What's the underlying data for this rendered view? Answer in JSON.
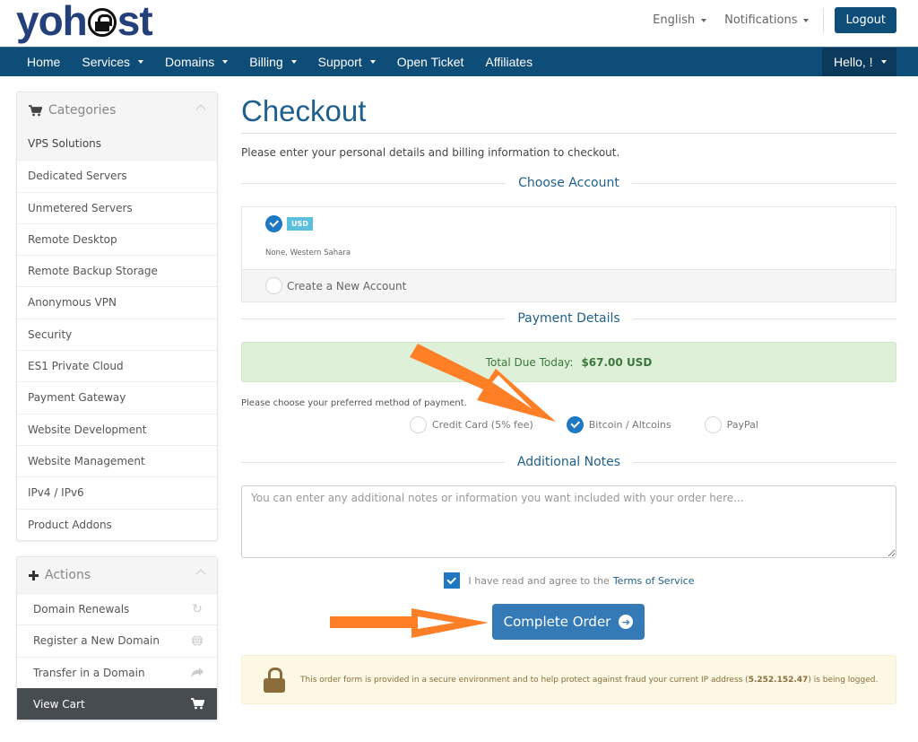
{
  "header": {
    "logo_text_left": "yoh",
    "logo_text_right": "st",
    "language": "English",
    "notifications": "Notifications",
    "logout": "Logout"
  },
  "nav": {
    "items": [
      {
        "label": "Home",
        "dropdown": false
      },
      {
        "label": "Services",
        "dropdown": true
      },
      {
        "label": "Domains",
        "dropdown": true
      },
      {
        "label": "Billing",
        "dropdown": true
      },
      {
        "label": "Support",
        "dropdown": true
      },
      {
        "label": "Open Ticket",
        "dropdown": false
      },
      {
        "label": "Affiliates",
        "dropdown": false
      }
    ],
    "account": "Hello, !"
  },
  "sidebar": {
    "categories_title": "Categories",
    "categories": [
      "VPS Solutions",
      "Dedicated Servers",
      "Unmetered Servers",
      "Remote Desktop",
      "Remote Backup Storage",
      "Anonymous VPN",
      "Security",
      "ES1 Private Cloud",
      "Payment Gateway",
      "Website Development",
      "Website Management",
      "IPv4 / IPv6",
      "Product Addons"
    ],
    "active_category": "VPS Solutions",
    "actions_title": "Actions",
    "actions": [
      {
        "label": "Domain Renewals",
        "icon": "refresh-icon"
      },
      {
        "label": "Register a New Domain",
        "icon": "globe-icon"
      },
      {
        "label": "Transfer in a Domain",
        "icon": "share-arrow-icon"
      },
      {
        "label": "View Cart",
        "icon": "cart-icon"
      }
    ]
  },
  "main": {
    "title": "Checkout",
    "intro": "Please enter your personal details and billing information to checkout.",
    "choose_account": {
      "heading": "Choose Account",
      "existing": {
        "currency": "USD",
        "address": "None, Western Sahara",
        "selected": true
      },
      "new_account": "Create a New Account"
    },
    "payment": {
      "heading": "Payment Details",
      "total_label": "Total Due Today:",
      "total_value": "$67.00 USD",
      "prompt": "Please choose your preferred method of payment.",
      "methods": [
        {
          "label": "Credit Card (5% fee)",
          "selected": false
        },
        {
          "label": "Bitcoin / Altcoins",
          "selected": true
        },
        {
          "label": "PayPal",
          "selected": false
        }
      ]
    },
    "notes": {
      "heading": "Additional Notes",
      "placeholder": "You can enter any additional notes or information you want included with your order here...",
      "value": ""
    },
    "tos": {
      "checked": true,
      "text": "I have read and agree to the",
      "link": "Terms of Service"
    },
    "complete_button": "Complete Order",
    "secure": {
      "text_before": "This order form is provided in a secure environment and to help protect against fraud your current IP address (",
      "ip": "5.252.152.47",
      "text_after": ") is being logged."
    }
  },
  "colors": {
    "brand": "#0f4d79",
    "accent": "#337ab7",
    "annotation_arrow": "#ff7f27",
    "success_bg": "#dff0d8",
    "warning_bg": "#fcf8e3"
  }
}
